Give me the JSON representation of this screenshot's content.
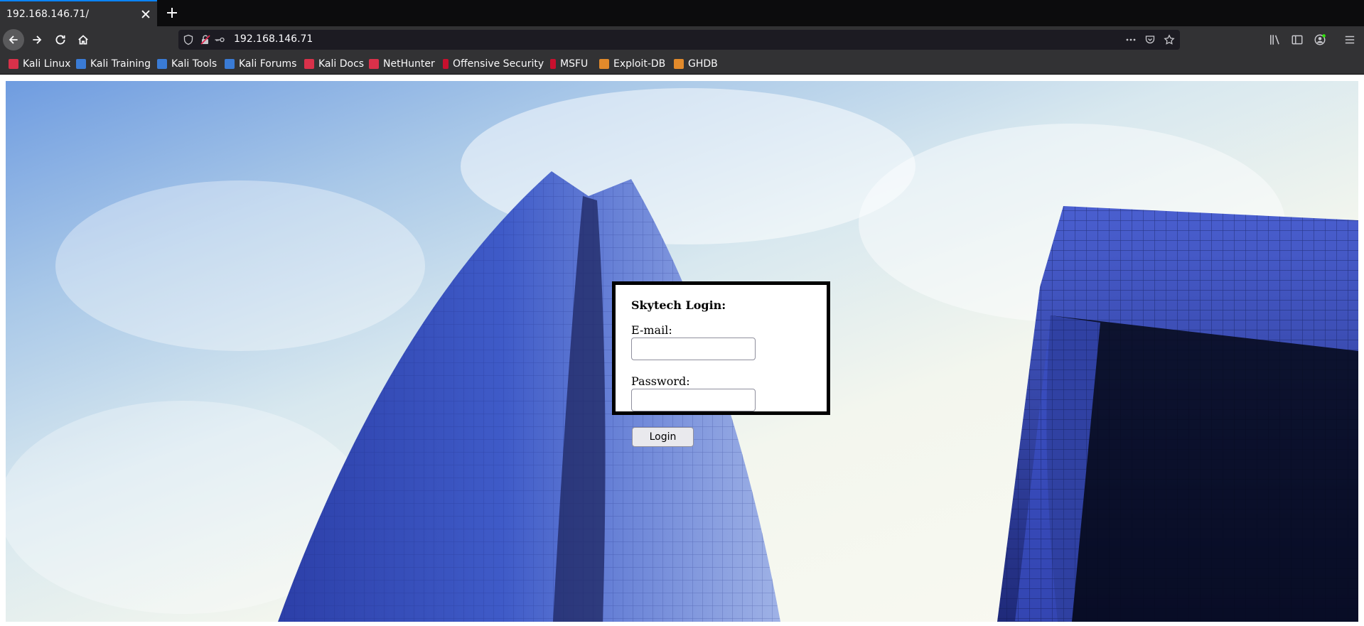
{
  "browser": {
    "tab_title": "192.168.146.71/",
    "url": "192.168.146.71",
    "accent_color": "#0a84ff"
  },
  "bookmarks": [
    {
      "label": "Kali Linux",
      "icon": "kali-dragon-icon",
      "color": "#d9314a"
    },
    {
      "label": "Kali Training",
      "icon": "kali-training-icon",
      "color": "#3a7bd5"
    },
    {
      "label": "Kali Tools",
      "icon": "kali-tools-icon",
      "color": "#3a7bd5"
    },
    {
      "label": "Kali Forums",
      "icon": "kali-forums-icon",
      "color": "#3a7bd5"
    },
    {
      "label": "Kali Docs",
      "icon": "kali-docs-icon",
      "color": "#d9314a"
    },
    {
      "label": "NetHunter",
      "icon": "nethunter-icon",
      "color": "#d9314a"
    },
    {
      "label": "Offensive Security",
      "icon": "offsec-icon",
      "color": "#c8102e"
    },
    {
      "label": "MSFU",
      "icon": "msfu-icon",
      "color": "#c8102e"
    },
    {
      "label": "Exploit-DB",
      "icon": "exploit-db-icon",
      "color": "#e28a2b"
    },
    {
      "label": "GHDB",
      "icon": "ghdb-icon",
      "color": "#e28a2b"
    }
  ],
  "login": {
    "title": "Skytech Login:",
    "email_label": "E-mail:",
    "email_value": "",
    "password_label": "Password:",
    "password_value": "",
    "button_label": "Login"
  }
}
